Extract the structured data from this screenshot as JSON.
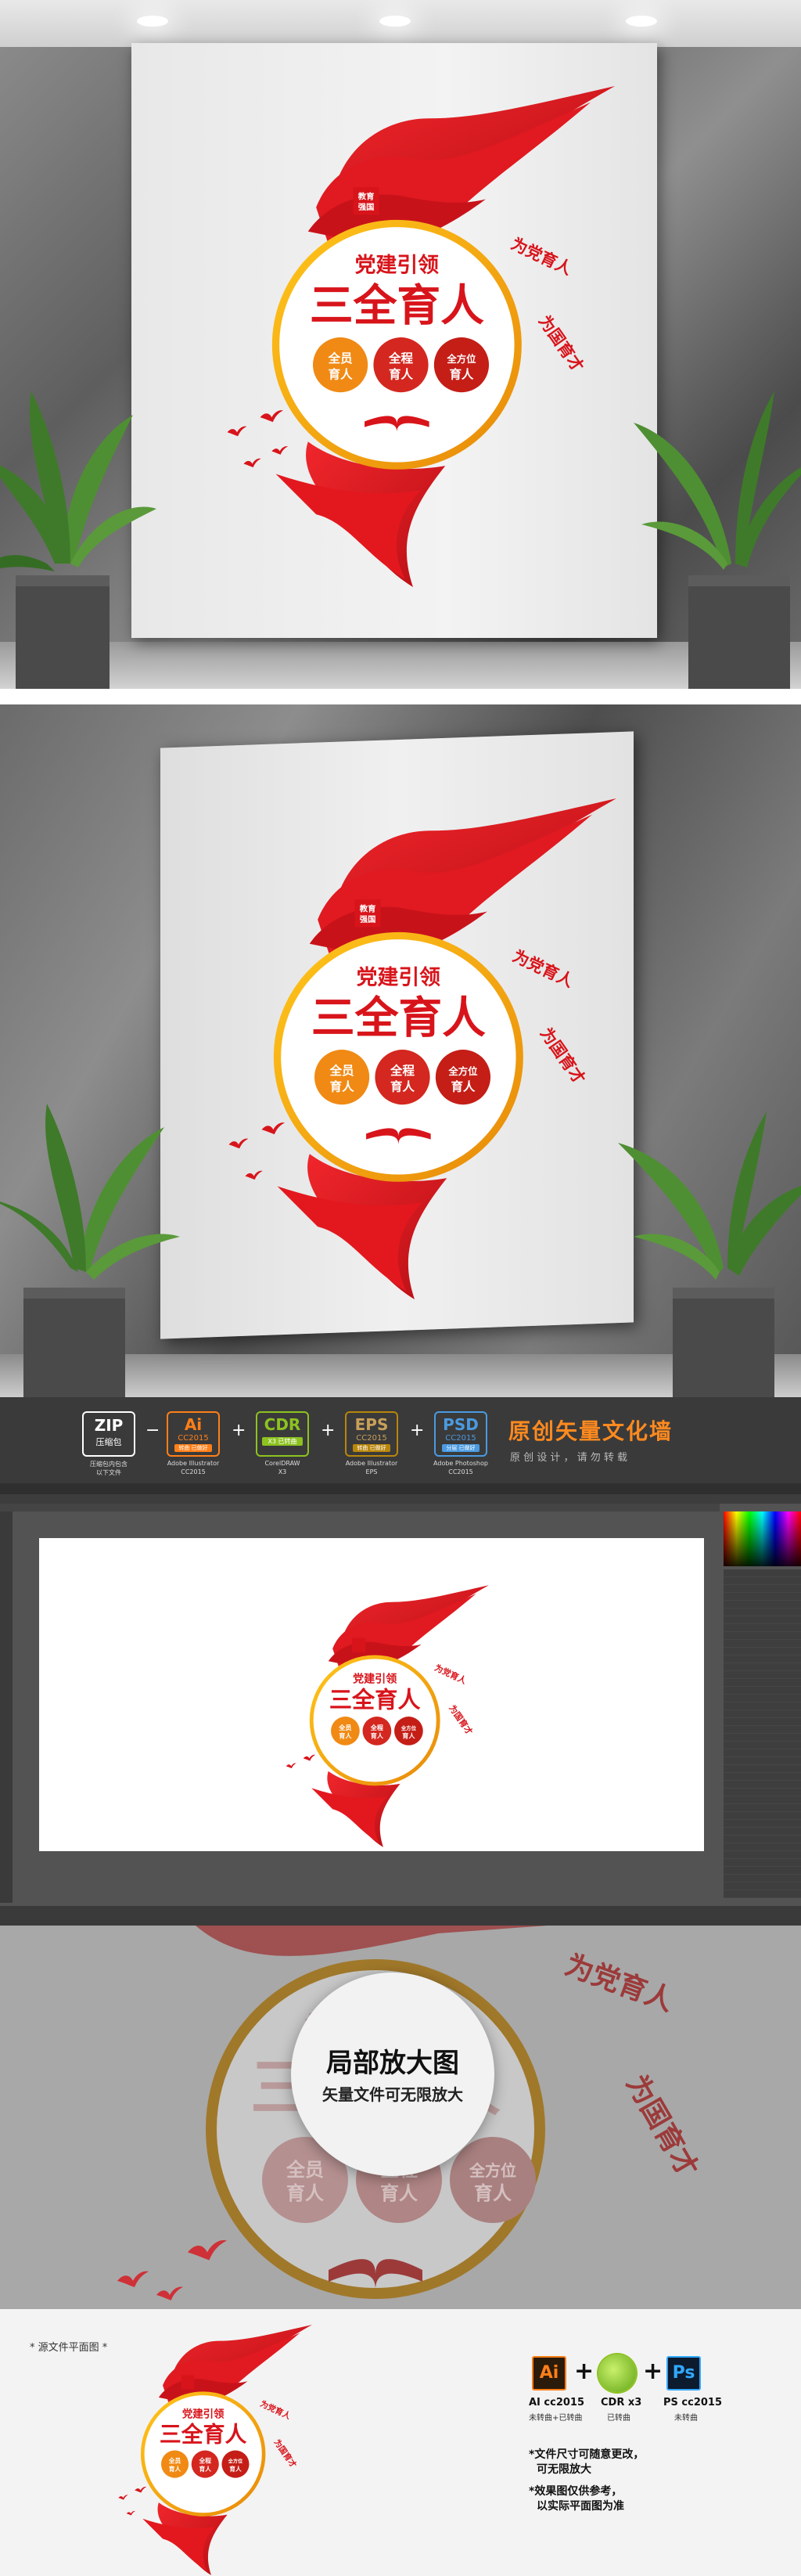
{
  "artwork": {
    "seal_text_1": "教育",
    "seal_text_2": "强国",
    "subtitle": "党建引领",
    "title": "三全育人",
    "circle_1_line1": "全员",
    "circle_1_line2": "育人",
    "circle_2_line1": "全程",
    "circle_2_line2": "育人",
    "circle_3_line1": "全方位",
    "circle_3_line2": "育人",
    "arc_text_1": "为党育人",
    "arc_text_2": "为国育才"
  },
  "formats": {
    "zip": {
      "tag": "ZIP",
      "label": "压缩包",
      "note1": "压缩包内包含",
      "note2": "以下文件"
    },
    "ai": {
      "tag": "Ai",
      "version": "CC2015",
      "sub": "转曲 已做好",
      "label1": "Adobe Illustrator",
      "label2": "CC2015"
    },
    "cdr": {
      "tag": "CDR",
      "version": "X3 已转曲",
      "label1": "CorelDRAW",
      "label2": "X3"
    },
    "eps": {
      "tag": "EPS",
      "version": "CC2015",
      "sub": "转曲 已做好",
      "label1": "Adobe Illustrator",
      "label2": "EPS"
    },
    "psd": {
      "tag": "PSD",
      "version": "CC2015",
      "sub": "分层 已做好",
      "label1": "Adobe Photoshop",
      "label2": "CC2015"
    },
    "separators": [
      "−",
      "+",
      "+",
      "+"
    ],
    "brand_title": "原创矢量文化墙",
    "brand_subtitle": "原 创 设 计 ， 请 勿 转 载"
  },
  "zoom": {
    "title": "局部放大图",
    "subtitle": "矢量文件可无限放大"
  },
  "bottom": {
    "source_label": "* 源文件平面图 *",
    "ai_tag": "Ai",
    "ai_label1": "AI cc2015",
    "ai_label2": "未转曲+已转曲",
    "cdr_label1": "CDR x3",
    "cdr_label2": "已转曲",
    "ps_tag": "Ps",
    "ps_label1": "PS cc2015",
    "ps_label2": "未转曲",
    "plus": "+",
    "note1_line1": "*文件尺寸可随意更改，",
    "note1_line2": "可无限放大",
    "note2_line1": "*效果图仅供参考，",
    "note2_line2": "以实际平面图为准"
  },
  "colors": {
    "red": "#d8141b",
    "orange": "#f2a20a",
    "circle_red": "#d4271f",
    "circle_orange": "#f08a14",
    "dark_bg": "#3a3a3a",
    "ai_orange": "#ff7f18",
    "cdr_green": "#8dc21f",
    "eps_tan": "#b8860b",
    "psd_blue": "#4a9ae0"
  }
}
